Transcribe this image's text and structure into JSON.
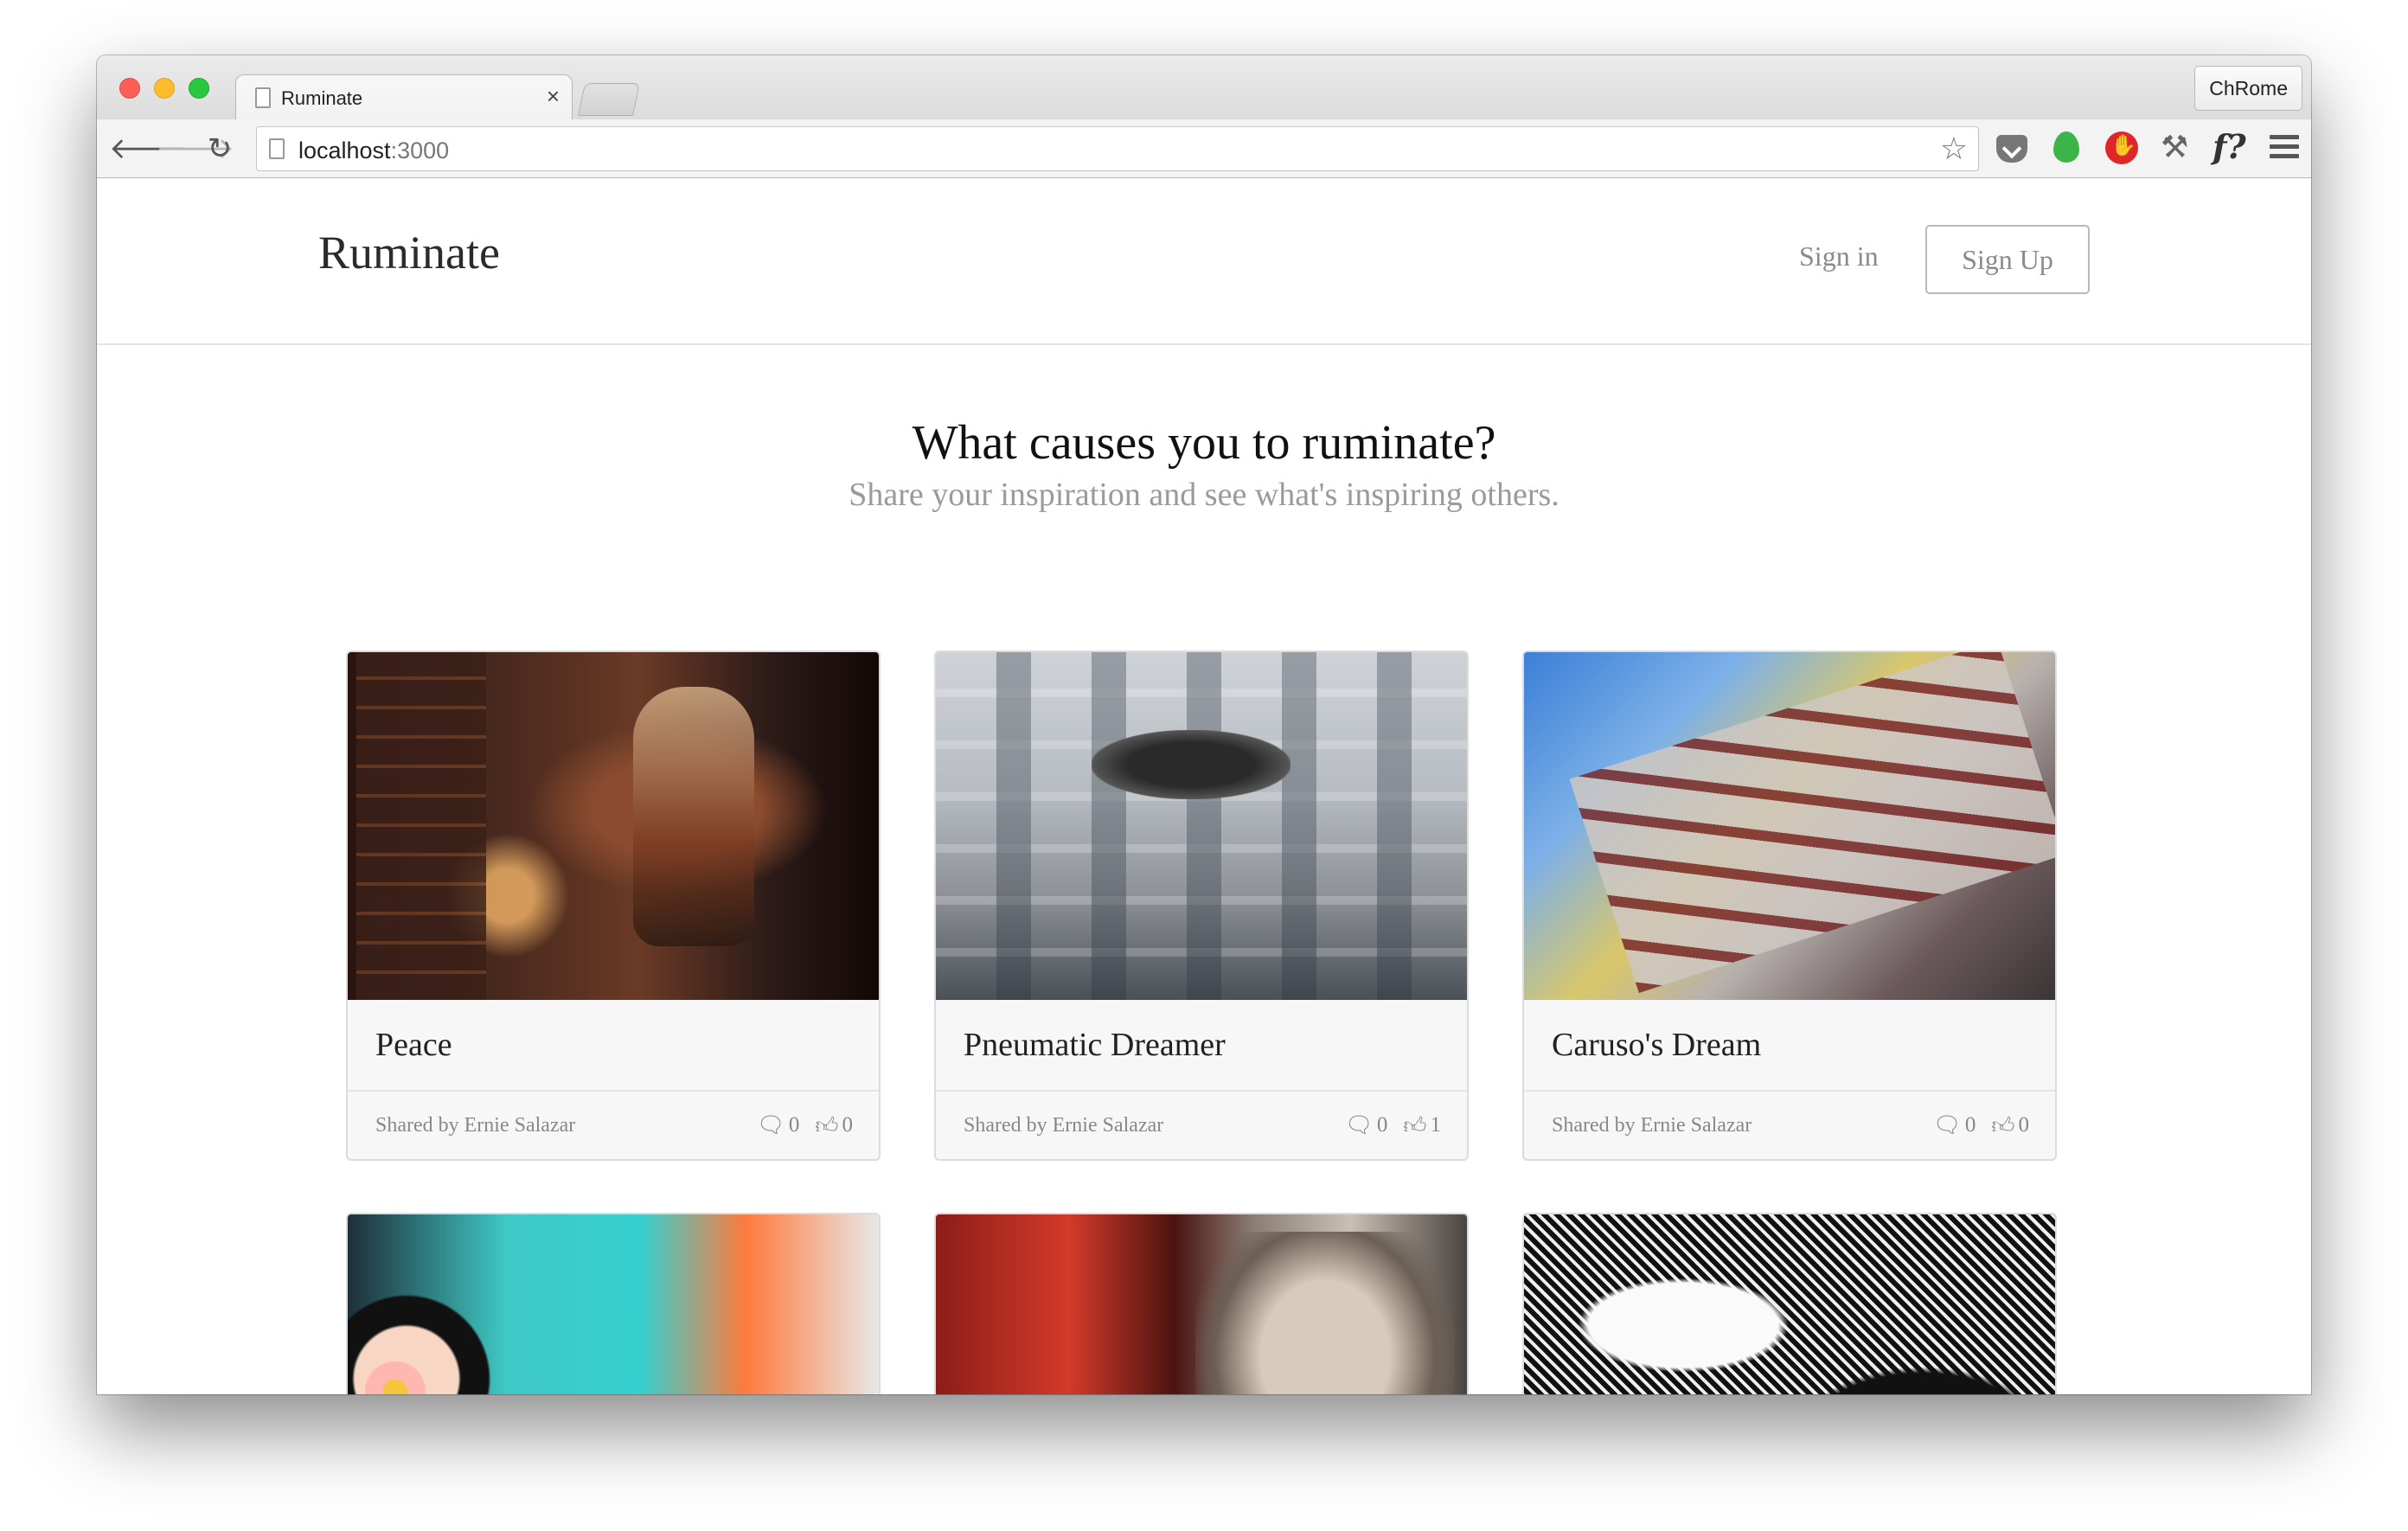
{
  "browser": {
    "tab_title": "Ruminate",
    "tab_close": "×",
    "profile": "ChRome",
    "url_host": "localhost",
    "url_port": ":3000",
    "extensions": [
      "pocket-icon",
      "evernote-icon",
      "adblock-icon",
      "devtools-icon",
      "whatfont-icon",
      "menu-icon"
    ]
  },
  "navbar": {
    "brand": "Ruminate",
    "signin": "Sign in",
    "signup": "Sign Up"
  },
  "hero": {
    "title": "What causes you to ruminate?",
    "subtitle": "Share your inspiration and see what's inspiring others."
  },
  "cards": [
    {
      "title": "Peace",
      "shared_by": "Shared by Ernie Salazar",
      "comments": "0",
      "likes": "0"
    },
    {
      "title": "Pneumatic Dreamer",
      "shared_by": "Shared by Ernie Salazar",
      "comments": "0",
      "likes": "1"
    },
    {
      "title": "Caruso's Dream",
      "shared_by": "Shared by Ernie Salazar",
      "comments": "0",
      "likes": "0"
    },
    {
      "title": "",
      "shared_by": "",
      "comments": "",
      "likes": ""
    },
    {
      "title": "",
      "shared_by": "",
      "comments": "",
      "likes": ""
    },
    {
      "title": "",
      "shared_by": "",
      "comments": "",
      "likes": ""
    }
  ],
  "icons": {
    "back": "🡐",
    "forward": "🡒",
    "reload": "↻",
    "star": "☆",
    "comment": "💬",
    "like": "👍"
  }
}
